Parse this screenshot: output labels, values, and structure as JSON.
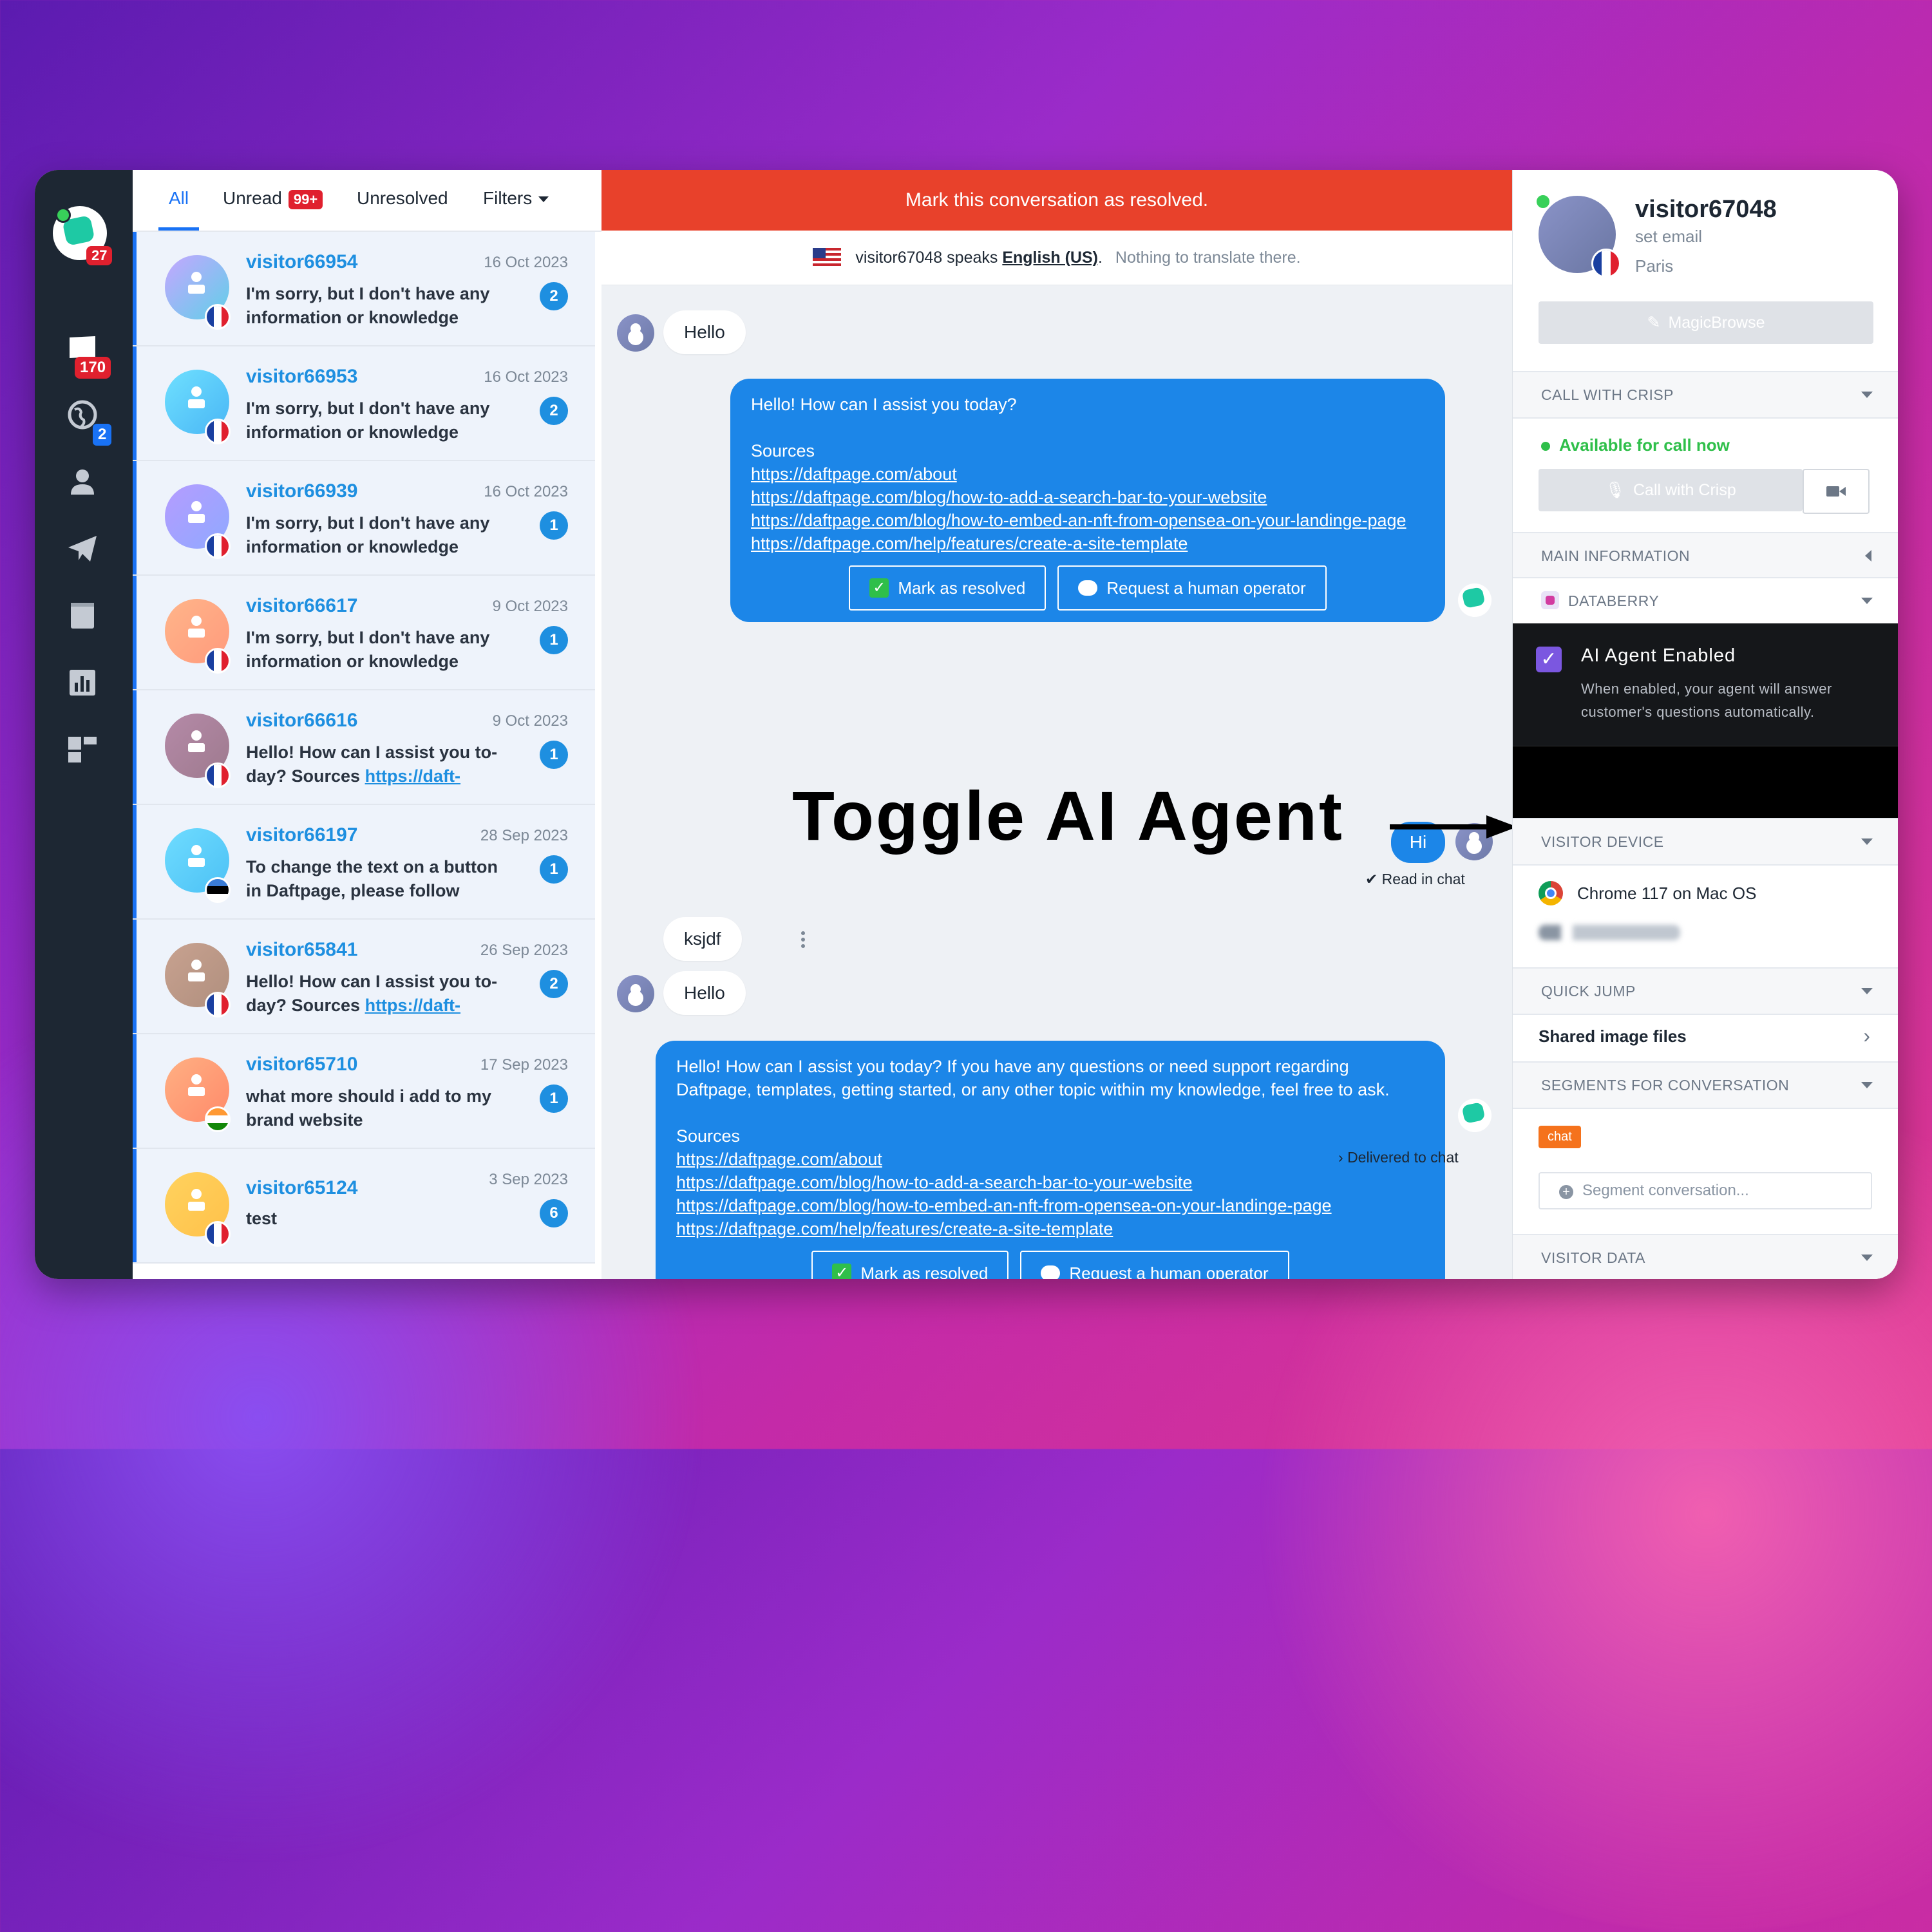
{
  "rail": {
    "logo_badge": "27",
    "inbox_badge": "170",
    "globe_badge": "2",
    "icons": [
      "inbox-icon",
      "globe-icon",
      "contacts-icon",
      "campaigns-icon",
      "helpdesk-icon",
      "analytics-icon",
      "plugins-icon"
    ]
  },
  "list": {
    "tabs": {
      "all": "All",
      "unread": "Unread",
      "unread_badge": "99+",
      "unresolved": "Unresolved",
      "filters": "Filters"
    },
    "conversations": [
      {
        "name": "visitor66954",
        "date": "16 Oct 2023",
        "msg": "I'm sorry, but I don't have any information or knowledge",
        "count": "2",
        "flag": "fr",
        "grad": [
          "#c6a6ff",
          "#5fd0e8"
        ]
      },
      {
        "name": "visitor66953",
        "date": "16 Oct 2023",
        "msg": "I'm sorry, but I don't have any information or knowledge",
        "count": "2",
        "flag": "fr",
        "grad": [
          "#6fe0ff",
          "#49b6f5"
        ]
      },
      {
        "name": "visitor66939",
        "date": "16 Oct 2023",
        "msg": "I'm sorry, but I don't have any information or knowledge",
        "count": "1",
        "flag": "fr",
        "grad": [
          "#b59cff",
          "#8fa9ff"
        ]
      },
      {
        "name": "visitor66617",
        "date": "9 Oct 2023",
        "msg": "I'm sorry, but I don't have any information or knowledge",
        "count": "1",
        "flag": "fr",
        "grad": [
          "#ffb58a",
          "#ff9a7c"
        ]
      },
      {
        "name": "visitor66616",
        "date": "9 Oct 2023",
        "msg": "Hello! How can I assist you to-day? Sources ",
        "link": "https://daft-",
        "count": "1",
        "flag": "fr",
        "grad": [
          "#b58aa8",
          "#9e7a8e"
        ]
      },
      {
        "name": "visitor66197",
        "date": "28 Sep 2023",
        "msg": "To change the text on a button in Daftpage, please follow",
        "count": "1",
        "flag": "ee",
        "grad": [
          "#6fdcff",
          "#4cc1f5"
        ]
      },
      {
        "name": "visitor65841",
        "date": "26 Sep 2023",
        "msg": "Hello! How can I assist you to-day? Sources ",
        "link": "https://daft-",
        "count": "2",
        "flag": "fr",
        "grad": [
          "#c8a290",
          "#b08f7e"
        ]
      },
      {
        "name": "visitor65710",
        "date": "17 Sep 2023",
        "msg": "what more should i add to my brand website",
        "count": "1",
        "flag": "in",
        "grad": [
          "#ffb083",
          "#ff8a6a"
        ]
      },
      {
        "name": "visitor65124",
        "date": "3 Sep 2023",
        "msg": "test",
        "count": "6",
        "flag": "fr",
        "grad": [
          "#ffd25e",
          "#ffc14a"
        ]
      }
    ]
  },
  "chat": {
    "resolve_banner": "Mark this conversation as resolved.",
    "translate": {
      "visitor": "visitor67048",
      "speaks": "speaks",
      "language": "English (US)",
      "note": "Nothing to translate there."
    },
    "msg1": "Hello",
    "bot1": {
      "text": "Hello! How can I assist you today?",
      "sources_label": "Sources",
      "links": [
        "https://daftpage.com/about",
        "https://daftpage.com/blog/how-to-add-a-search-bar-to-your-website",
        "https://daftpage.com/blog/how-to-embed-an-nft-from-opensea-on-your-landinge-page",
        "https://daftpage.com/help/features/create-a-site-template"
      ],
      "resolve_btn": "Mark as resolved",
      "human_btn": "Request a human operator"
    },
    "toggle_caption": "Toggle AI Agent",
    "hi": "Hi",
    "read_status": "Read in chat",
    "msg2": "ksjdf",
    "msg3": "Hello",
    "bot2": {
      "text": "Hello! How can I assist you today? If you have any questions or need support regarding Daftpage, templates, getting started, or any other topic within my knowledge, feel free to ask.",
      "sources_label": "Sources",
      "links": [
        "https://daftpage.com/about",
        "https://daftpage.com/blog/how-to-add-a-search-bar-to-your-website",
        "https://daftpage.com/blog/how-to-embed-an-nft-from-opensea-on-your-landinge-page",
        "https://daftpage.com/help/features/create-a-site-template"
      ],
      "resolve_btn": "Mark as resolved",
      "human_btn": "Request a human operator"
    },
    "delivered_status": "Delivered to chat"
  },
  "panel": {
    "name": "visitor67048",
    "email": "set email",
    "city": "Paris",
    "magicbrowse": "MagicBrowse",
    "call_section": "CALL WITH CRISP",
    "available": "Available for call now",
    "call_btn": "Call with Crisp",
    "main_info": "MAIN INFORMATION",
    "databerry": "DATABERRY",
    "ai_title": "AI Agent Enabled",
    "ai_desc": "When enabled, your agent will answer customer's questions automatically.",
    "device_section": "VISITOR DEVICE",
    "browser": "Chrome 117 on Mac OS",
    "quick_jump": "QUICK JUMP",
    "shared_files": "Shared image files",
    "segments": "SEGMENTS FOR CONVERSATION",
    "chip": "chat",
    "segment_placeholder": "Segment conversation...",
    "visitor_data": "VISITOR DATA"
  }
}
